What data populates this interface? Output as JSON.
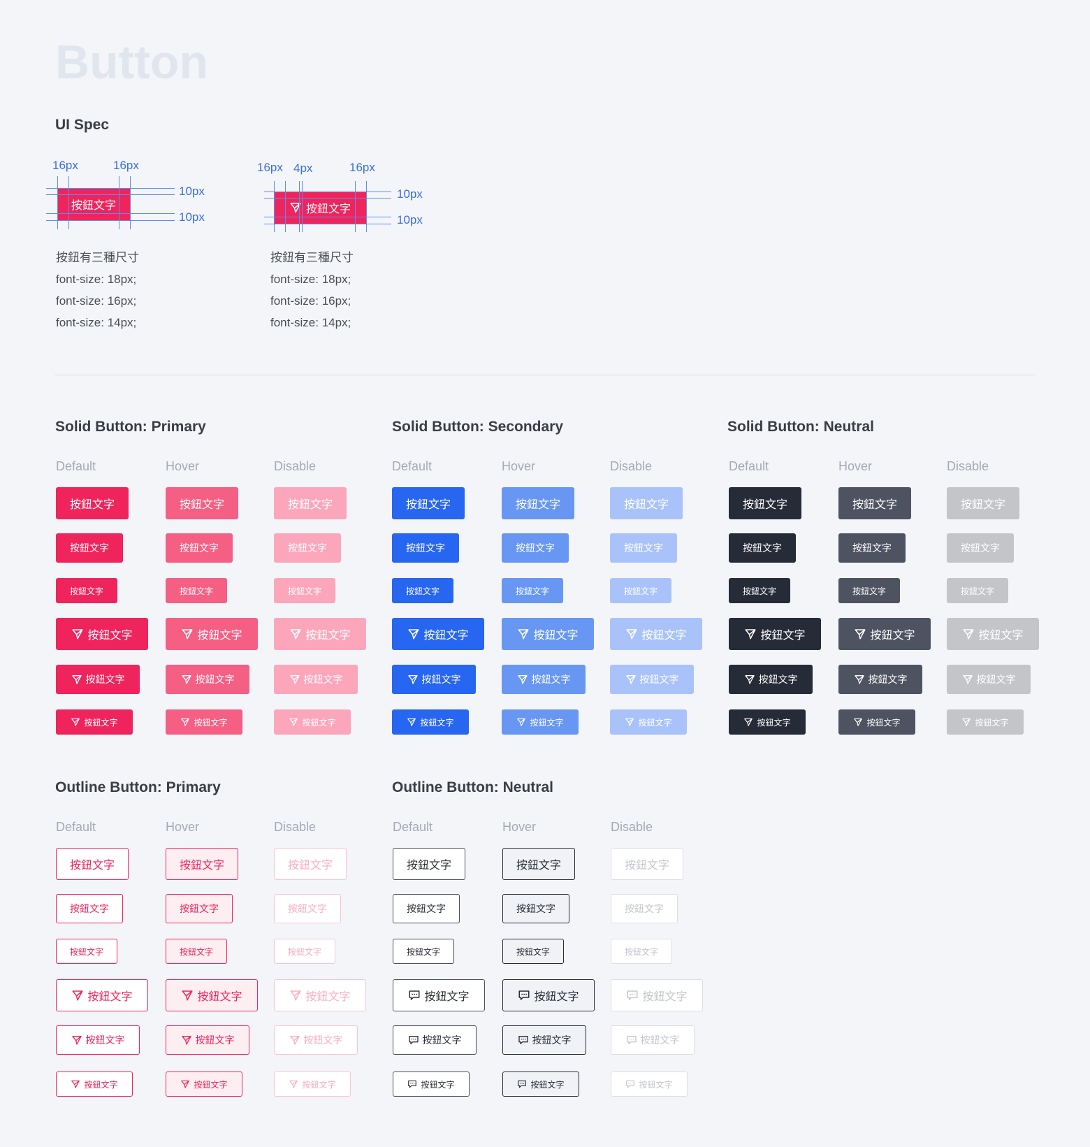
{
  "page_title": "Button",
  "ui_spec": {
    "title": "UI Spec",
    "ann_16px": "16px",
    "ann_4px": "4px",
    "ann_10px": "10px",
    "button_text": "按鈕文字",
    "notes": [
      "按鈕有三種尺寸",
      "font-size: 18px;",
      "font-size: 16px;",
      "font-size: 14px;"
    ]
  },
  "states": {
    "default": "Default",
    "hover": "Hover",
    "disable": "Disable"
  },
  "button_text": "按鈕文字",
  "sections": {
    "solid_primary": "Solid Button: Primary",
    "solid_secondary": "Solid Button: Secondary",
    "solid_neutral": "Solid Button: Neutral",
    "outline_primary": "Outline Button: Primary",
    "outline_neutral": "Outline Button: Neutral"
  },
  "icons": {
    "solid_icon": "send-icon",
    "outline_primary_icon": "send-icon",
    "outline_neutral_icon": "message-icon"
  },
  "colors": {
    "primary": "#f0245c",
    "secondary": "#2766f0",
    "neutral": "#262b38",
    "guide_blue": "#3b6fe0"
  }
}
